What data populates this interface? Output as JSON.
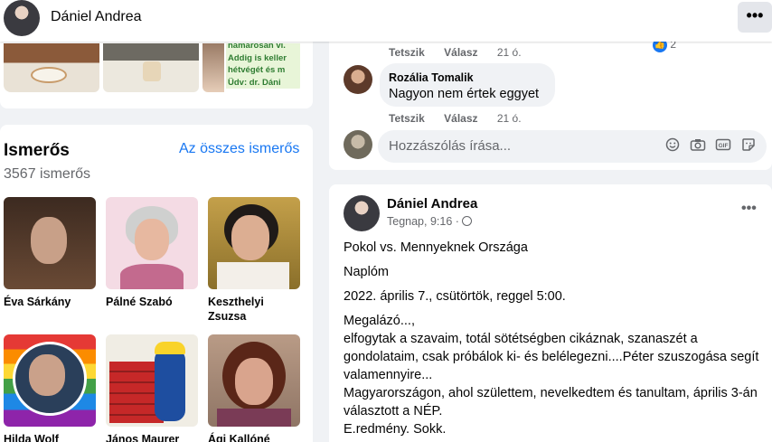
{
  "header": {
    "name": "Dániel Andrea",
    "more_label": "•••"
  },
  "photos": {
    "text_snippet": [
      "hamarosan vi.",
      "Addig is keller",
      "hétvégét és m",
      "Üdv: dr. Dáni"
    ]
  },
  "friends": {
    "title": "Ismerős",
    "count": "3567 ismerős",
    "see_all": "Az összes ismerős",
    "items": [
      {
        "name": "Éva Sárkány"
      },
      {
        "name": "Pálné Szabó"
      },
      {
        "name": "Keszthelyi Zsuzsa"
      },
      {
        "name": "Hilda Wolf"
      },
      {
        "name": "János Maurer"
      },
      {
        "name": "Ági Kallóné"
      }
    ]
  },
  "comments": {
    "top_actions": {
      "like": "Tetszik",
      "reply": "Válasz",
      "time": "21 ó."
    },
    "reaction_count": "2",
    "comment": {
      "author": "Rozália Tomalik",
      "text": "Nagyon nem értek eggyet",
      "actions": {
        "like": "Tetszik",
        "reply": "Válasz",
        "time": "21 ó."
      }
    },
    "input_placeholder": "Hozzászólás írása..."
  },
  "post": {
    "author": "Dániel Andrea",
    "meta": "Tegnap, 9:16 ·",
    "more_label": "•••",
    "paragraphs": [
      "Pokol vs. Mennyeknek Országa",
      "Naplóm",
      "2022. április 7., csütörtök, reggel 5:00.",
      "Megalázó...,\nelfogytak a szavaim, totál sötétségben cikáznak, szanaszét a gondolataim, csak próbálok ki- és belélegezni....Péter szuszogása segít valamennyire...\nMagyarországon, ahol születtem, nevelkedtem és tanultam, április 3-án választott a NÉP.\nE.redmény. Sokk."
    ]
  }
}
